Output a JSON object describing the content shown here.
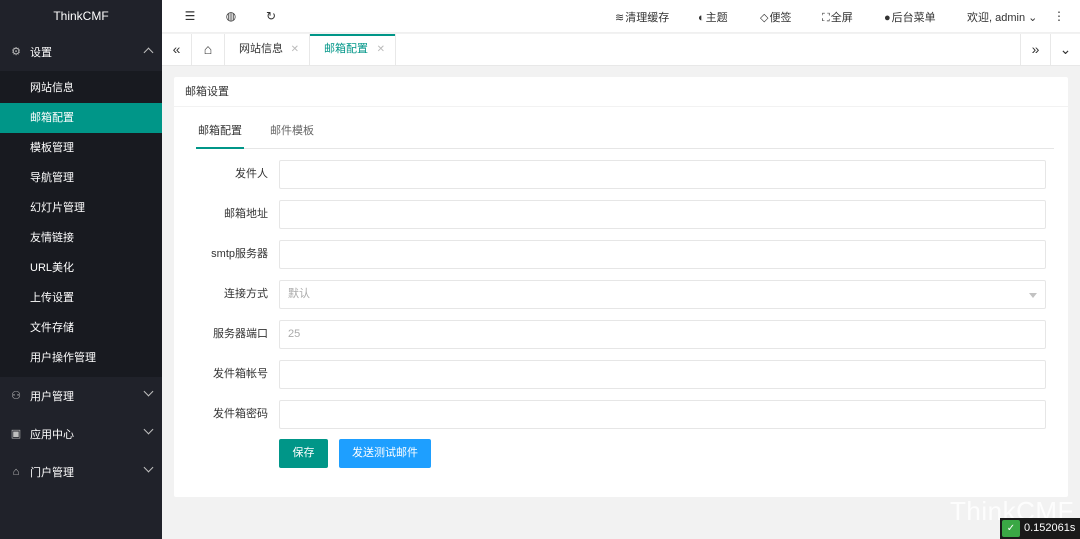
{
  "app": {
    "logo": "ThinkCMF"
  },
  "sidebar": {
    "groups": [
      {
        "label": "设置",
        "icon": "gear-icon",
        "expanded": true,
        "items": [
          {
            "label": "网站信息"
          },
          {
            "label": "邮箱配置",
            "active": true
          },
          {
            "label": "模板管理"
          },
          {
            "label": "导航管理"
          },
          {
            "label": "幻灯片管理"
          },
          {
            "label": "友情链接"
          },
          {
            "label": "URL美化"
          },
          {
            "label": "上传设置"
          },
          {
            "label": "文件存储"
          },
          {
            "label": "用户操作管理"
          }
        ]
      },
      {
        "label": "用户管理",
        "icon": "user-icon"
      },
      {
        "label": "应用中心",
        "icon": "apps-icon"
      },
      {
        "label": "门户管理",
        "icon": "home-icon"
      }
    ]
  },
  "topbar": {
    "icons": [
      "menu-toggle-icon",
      "globe-icon",
      "refresh-icon"
    ],
    "links": [
      {
        "label": "清理缓存",
        "icon": "layers-icon"
      },
      {
        "label": "主题",
        "icon": "palette-icon"
      },
      {
        "label": "便签",
        "icon": "tag-icon"
      },
      {
        "label": "全屏",
        "icon": "fullscreen-icon"
      },
      {
        "label": "后台菜单",
        "icon": "dot-icon"
      }
    ],
    "user": "欢迎, admin"
  },
  "tabs": [
    {
      "label": "网站信息"
    },
    {
      "label": "邮箱配置",
      "active": true
    }
  ],
  "card": {
    "title": "邮箱设置",
    "subtabs": [
      {
        "label": "邮箱配置",
        "active": true
      },
      {
        "label": "邮件模板"
      }
    ],
    "fields": [
      {
        "label": "发件人",
        "value": ""
      },
      {
        "label": "邮箱地址",
        "value": ""
      },
      {
        "label": "smtp服务器",
        "value": ""
      },
      {
        "label": "连接方式",
        "value": "默认",
        "type": "select"
      },
      {
        "label": "服务器端口",
        "value": "25"
      },
      {
        "label": "发件箱帐号",
        "value": ""
      },
      {
        "label": "发件箱密码",
        "value": ""
      }
    ],
    "buttons": {
      "save": "保存",
      "test": "发送测试邮件"
    }
  },
  "watermark": "ThinkCMF",
  "timing": "0.152061s",
  "colors": {
    "accent": "#009688",
    "blue": "#1e9fff",
    "sidebar": "#20222a"
  }
}
